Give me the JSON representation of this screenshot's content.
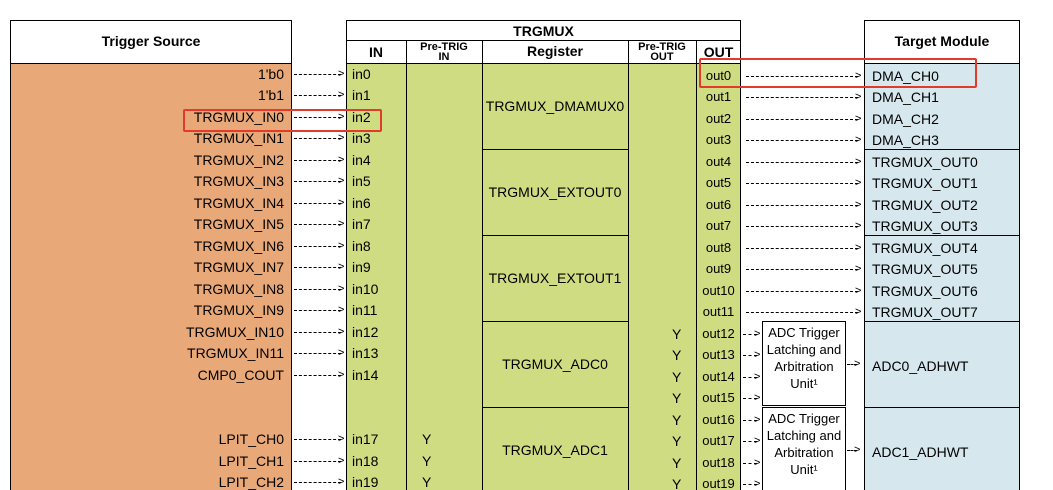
{
  "headers": {
    "trigger_source": "Trigger Source",
    "trgmux": "TRGMUX",
    "in": "IN",
    "pre_trig_in": "Pre-TRIG\nIN",
    "register": "Register",
    "pre_trig_out": "Pre-TRIG\nOUT",
    "out": "OUT",
    "target_module": "Target Module"
  },
  "rows": [
    {
      "source": "1'b0",
      "in": "in0",
      "pre_in": "",
      "pre_out": "",
      "out": "out0"
    },
    {
      "source": "1'b1",
      "in": "in1",
      "pre_in": "",
      "pre_out": "",
      "out": "out1"
    },
    {
      "source": "TRGMUX_IN0",
      "in": "in2",
      "pre_in": "",
      "pre_out": "",
      "out": "out2"
    },
    {
      "source": "TRGMUX_IN1",
      "in": "in3",
      "pre_in": "",
      "pre_out": "",
      "out": "out3"
    },
    {
      "source": "TRGMUX_IN2",
      "in": "in4",
      "pre_in": "",
      "pre_out": "",
      "out": "out4"
    },
    {
      "source": "TRGMUX_IN3",
      "in": "in5",
      "pre_in": "",
      "pre_out": "",
      "out": "out5"
    },
    {
      "source": "TRGMUX_IN4",
      "in": "in6",
      "pre_in": "",
      "pre_out": "",
      "out": "out6"
    },
    {
      "source": "TRGMUX_IN5",
      "in": "in7",
      "pre_in": "",
      "pre_out": "",
      "out": "out7"
    },
    {
      "source": "TRGMUX_IN6",
      "in": "in8",
      "pre_in": "",
      "pre_out": "",
      "out": "out8"
    },
    {
      "source": "TRGMUX_IN7",
      "in": "in9",
      "pre_in": "",
      "pre_out": "",
      "out": "out9"
    },
    {
      "source": "TRGMUX_IN8",
      "in": "in10",
      "pre_in": "",
      "pre_out": "",
      "out": "out10"
    },
    {
      "source": "TRGMUX_IN9",
      "in": "in11",
      "pre_in": "",
      "pre_out": "",
      "out": "out11"
    },
    {
      "source": "TRGMUX_IN10",
      "in": "in12",
      "pre_in": "",
      "pre_out": "Y",
      "out": "out12"
    },
    {
      "source": "TRGMUX_IN11",
      "in": "in13",
      "pre_in": "",
      "pre_out": "Y",
      "out": "out13"
    },
    {
      "source": "CMP0_COUT",
      "in": "in14",
      "pre_in": "",
      "pre_out": "Y",
      "out": "out14"
    },
    {
      "source": "",
      "in": "",
      "pre_in": "",
      "pre_out": "Y",
      "out": "out15"
    },
    {
      "source": "",
      "in": "",
      "pre_in": "",
      "pre_out": "Y",
      "out": "out16"
    },
    {
      "source": "LPIT_CH0",
      "in": "in17",
      "pre_in": "Y",
      "pre_out": "Y",
      "out": "out17"
    },
    {
      "source": "LPIT_CH1",
      "in": "in18",
      "pre_in": "Y",
      "pre_out": "Y",
      "out": "out18"
    },
    {
      "source": "LPIT_CH2",
      "in": "in19",
      "pre_in": "Y",
      "pre_out": "Y",
      "out": "out19"
    }
  ],
  "registers": [
    {
      "name": "TRGMUX_DMAMUX0",
      "rows": [
        0,
        3
      ]
    },
    {
      "name": "TRGMUX_EXTOUT0",
      "rows": [
        4,
        7
      ]
    },
    {
      "name": "TRGMUX_EXTOUT1",
      "rows": [
        8,
        11
      ]
    },
    {
      "name": "TRGMUX_ADC0",
      "rows": [
        12,
        15
      ]
    },
    {
      "name": "TRGMUX_ADC1",
      "rows": [
        16,
        19
      ]
    }
  ],
  "targets": [
    {
      "label": "DMA_CH0",
      "rows": [
        0,
        0
      ]
    },
    {
      "label": "DMA_CH1",
      "rows": [
        1,
        1
      ]
    },
    {
      "label": "DMA_CH2",
      "rows": [
        2,
        2
      ]
    },
    {
      "label": "DMA_CH3",
      "rows": [
        3,
        3
      ]
    },
    {
      "label": "TRGMUX_OUT0",
      "rows": [
        4,
        4
      ]
    },
    {
      "label": "TRGMUX_OUT1",
      "rows": [
        5,
        5
      ]
    },
    {
      "label": "TRGMUX_OUT2",
      "rows": [
        6,
        6
      ]
    },
    {
      "label": "TRGMUX_OUT3",
      "rows": [
        7,
        7
      ]
    },
    {
      "label": "TRGMUX_OUT4",
      "rows": [
        8,
        8
      ]
    },
    {
      "label": "TRGMUX_OUT5",
      "rows": [
        9,
        9
      ]
    },
    {
      "label": "TRGMUX_OUT6",
      "rows": [
        10,
        10
      ]
    },
    {
      "label": "TRGMUX_OUT7",
      "rows": [
        11,
        11
      ]
    },
    {
      "label": "ADC0_ADHWT",
      "rows": [
        12,
        15
      ]
    },
    {
      "label": "ADC1_ADHWT",
      "rows": [
        16,
        19
      ]
    }
  ],
  "latching_units": [
    {
      "label": "ADC Trigger Latching and Arbitration Unit¹",
      "rows": [
        12,
        15
      ]
    },
    {
      "label": "ADC Trigger Latching and Arbitration Unit¹",
      "rows": [
        16,
        19
      ]
    }
  ],
  "highlights": [
    {
      "target": "source",
      "row": 2
    },
    {
      "target": "out",
      "row": 0
    }
  ],
  "colors": {
    "source_bg": "#e8a877",
    "trgmux_bg": "#cfdc82",
    "target_bg": "#d6e8ee",
    "highlight": "#e03b2b",
    "header_bg": "#ffffff"
  }
}
